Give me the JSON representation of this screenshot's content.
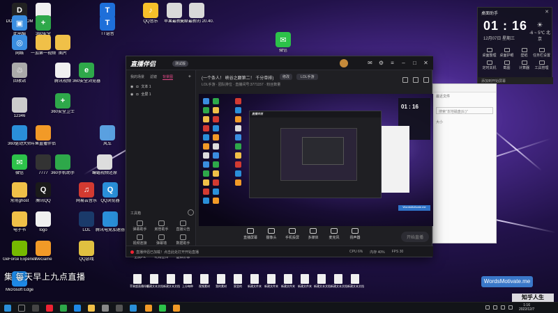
{
  "desktop": {
    "icons": [
      {
        "label": "DOUYIN.COM",
        "color": "#222",
        "g": "D"
      },
      {
        "label": "360优化",
        "color": "#f0f0f0",
        "g": ""
      },
      {
        "label": "",
        "color": "#1e6fd9",
        "g": "T"
      },
      {
        "label": "QQ音乐",
        "color": "#f7c02a",
        "g": "♪"
      },
      {
        "label": "苹果最新的",
        "color": "#d9d9d9",
        "g": ""
      },
      {
        "label": "安卓最新的 20.40.1.11",
        "color": "#d9d9d9",
        "g": ""
      },
      {
        "label": "此电脑",
        "color": "#3a8de0",
        "g": "▣"
      },
      {
        "label": "360安全",
        "color": "#2ea84a",
        "g": "+"
      },
      {
        "label": "TT语音",
        "color": "#1e6fd9",
        "g": "T"
      },
      {
        "label": "微信",
        "color": "#2dc24a",
        "g": "✉"
      },
      {
        "label": "网络",
        "color": "#3a8de0",
        "g": "◎"
      },
      {
        "label": "一加第一视频",
        "color": "#f0c048",
        "g": ""
      },
      {
        "label": "图片",
        "color": "#f0c048",
        "g": ""
      },
      {
        "label": "回收站",
        "color": "#aaa",
        "g": "♲"
      },
      {
        "label": "腾讯视频",
        "color": "#f0f0f0",
        "g": ""
      },
      {
        "label": "360安全浏览器",
        "color": "#2ea84a",
        "g": "e"
      },
      {
        "label": "12346",
        "color": "#ccc",
        "g": ""
      },
      {
        "label": "360安全卫士",
        "color": "#2ea84a",
        "g": "+"
      },
      {
        "label": "360驱动大师",
        "color": "#2a8fd9",
        "g": ""
      },
      {
        "label": "斗鱼直播伴侣",
        "color": "#f29a27",
        "g": ""
      },
      {
        "label": "风车",
        "color": "#5aa0e0",
        "g": ""
      },
      {
        "label": "微信",
        "color": "#2dc24a",
        "g": "✉"
      },
      {
        "label": "7777",
        "color": "#333",
        "g": ""
      },
      {
        "label": "360手机助手",
        "color": "#2ea84a",
        "g": ""
      },
      {
        "label": "蝙蝠视频还原",
        "color": "#ddd",
        "g": ""
      },
      {
        "label": "常用ghost",
        "color": "#f0c048",
        "g": ""
      },
      {
        "label": "腾讯QQ",
        "color": "#1a1a1a",
        "g": "Q"
      },
      {
        "label": "网易云音乐",
        "color": "#d33a31",
        "g": "♫"
      },
      {
        "label": "QQ浏览器",
        "color": "#2a8fd9",
        "g": "Q"
      },
      {
        "label": "电子书",
        "color": "#f0c048",
        "g": ""
      },
      {
        "label": "logo",
        "color": "#f0f0f0",
        "g": ""
      },
      {
        "label": "LOL",
        "color": "#1a3a6a",
        "g": ""
      },
      {
        "label": "腾讯电竞加速器",
        "color": "#2a8fd9",
        "g": ""
      },
      {
        "label": "GeForce Experience",
        "color": "#76b900",
        "g": ""
      },
      {
        "label": "WeGame",
        "color": "#f29a27",
        "g": ""
      },
      {
        "label": "QQ游戏",
        "color": "#e0c040",
        "g": ""
      },
      {
        "label": "Microsoft Edge",
        "color": "#1e88e5",
        "g": "e"
      }
    ],
    "files": [
      "苹果超直播伴侣",
      "新建文本文档",
      "新建文本文档",
      "上分每种",
      "视频素材",
      "我的素材",
      "家里的",
      "新建文件夹",
      "新建文件夹",
      "新建文件夹",
      "新建文件夹",
      "新建文本文档",
      "新建文本文档",
      "新建文本文档"
    ],
    "overlay_text": "集 每天早上九点直播",
    "watermark": "WordsMotivate.me",
    "corner_badge": "知乎人生"
  },
  "widget": {
    "title": "桌面助手",
    "time": "01 : 16",
    "date": "12月07日 星期三",
    "weather": "-6 ~ 5℃ 北京",
    "items": [
      "桌面整理",
      "桌面护眼",
      "壁纸",
      "任务栏设置",
      "定时关机",
      "截图",
      "计算器",
      "工具管理"
    ],
    "footer": "添加到开始屏幕"
  },
  "explorer": {
    "bar": "最近文件",
    "search": "搜索\"本地磁盘(E:)\"",
    "side": "大小"
  },
  "app": {
    "logo": "直播伴侣",
    "version": "测试版",
    "tabs": [
      "我的场景",
      "滤镜",
      "背景图"
    ],
    "active_tab": 2,
    "scenes": [
      {
        "label": "文本 1"
      },
      {
        "label": "全屏 1"
      }
    ],
    "title": "(一个条人！ 峡谷之巅第二！ 千分单排)",
    "edit_label": "修改",
    "category": "LOL手游",
    "subinfo": "LOL手游 · 团队排位 · 直播间号:3771157 · 粉丝数量",
    "tools_title": "工具箱",
    "tools": [
      "弹幕助手",
      "房管助手",
      "直播公告",
      "视频连接",
      "弹幕墙",
      "数据助手",
      "全民PK",
      "礼物宣传",
      "虚拟形象"
    ],
    "toolbar": [
      {
        "label": "直播屏幕"
      },
      {
        "label": "摄像头"
      },
      {
        "label": "手机投屏"
      },
      {
        "label": "多媒体"
      },
      {
        "label": "麦克风"
      },
      {
        "label": "扬声器"
      }
    ],
    "start_label": "开始直播",
    "status_msg": "直播伴侣已加载！点击此处打开开始直播",
    "stats": [
      "CPU 6%",
      "内存 40%",
      "FPS 30"
    ],
    "preview_badge": "WordsMotivate.me"
  },
  "taskbar": {
    "clock_time": "1:16",
    "clock_date": "2022/12/7"
  }
}
